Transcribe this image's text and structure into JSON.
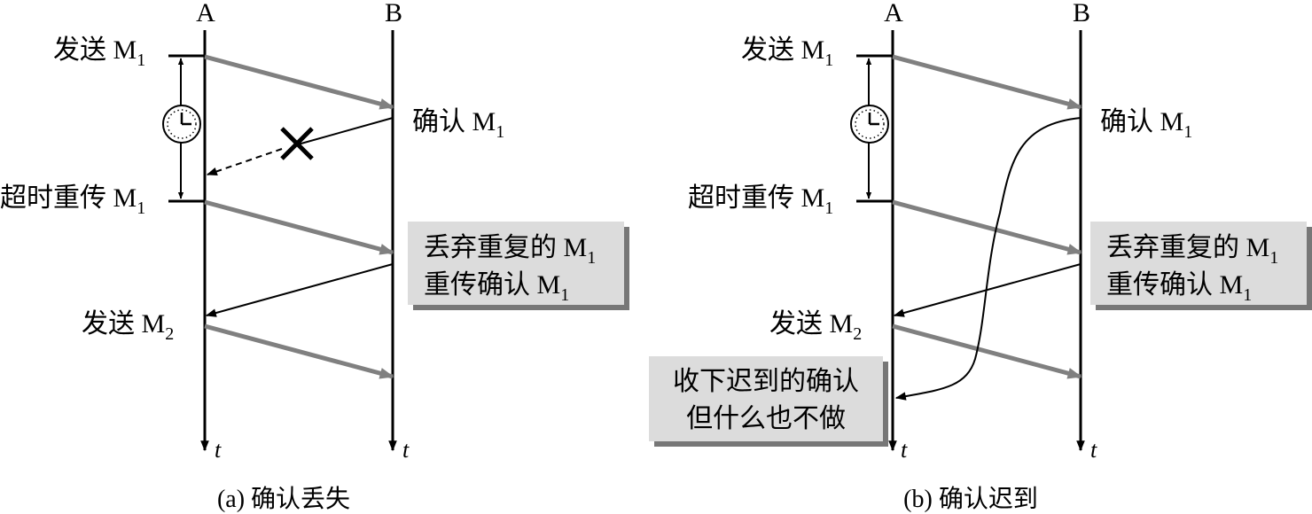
{
  "diagrams": [
    {
      "id": "a",
      "caption": "(a) 确认丢失",
      "node_a": "A",
      "node_b": "B",
      "time_a": "t",
      "time_b": "t",
      "send_m1": {
        "text": "发送 M",
        "sub": "1"
      },
      "ack_m1": {
        "text": "确认 M",
        "sub": "1"
      },
      "retx_m1": {
        "text": "超时重传 M",
        "sub": "1"
      },
      "send_m2": {
        "text": "发送 M",
        "sub": "2"
      },
      "box": {
        "line1": {
          "text": "丢弃重复的 M",
          "sub": "1"
        },
        "line2": {
          "text": "重传确认 M",
          "sub": "1"
        }
      }
    },
    {
      "id": "b",
      "caption": "(b) 确认迟到",
      "node_a": "A",
      "node_b": "B",
      "time_a": "t",
      "time_b": "t",
      "send_m1": {
        "text": "发送 M",
        "sub": "1"
      },
      "ack_m1": {
        "text": "确认 M",
        "sub": "1"
      },
      "retx_m1": {
        "text": "超时重传 M",
        "sub": "1"
      },
      "send_m2": {
        "text": "发送 M",
        "sub": "2"
      },
      "box": {
        "line1": {
          "text": "丢弃重复的 M",
          "sub": "1"
        },
        "line2": {
          "text": "重传确认 M",
          "sub": "1"
        }
      },
      "late_box": {
        "line1": "收下迟到的确认",
        "line2": "但什么也不做"
      }
    }
  ]
}
